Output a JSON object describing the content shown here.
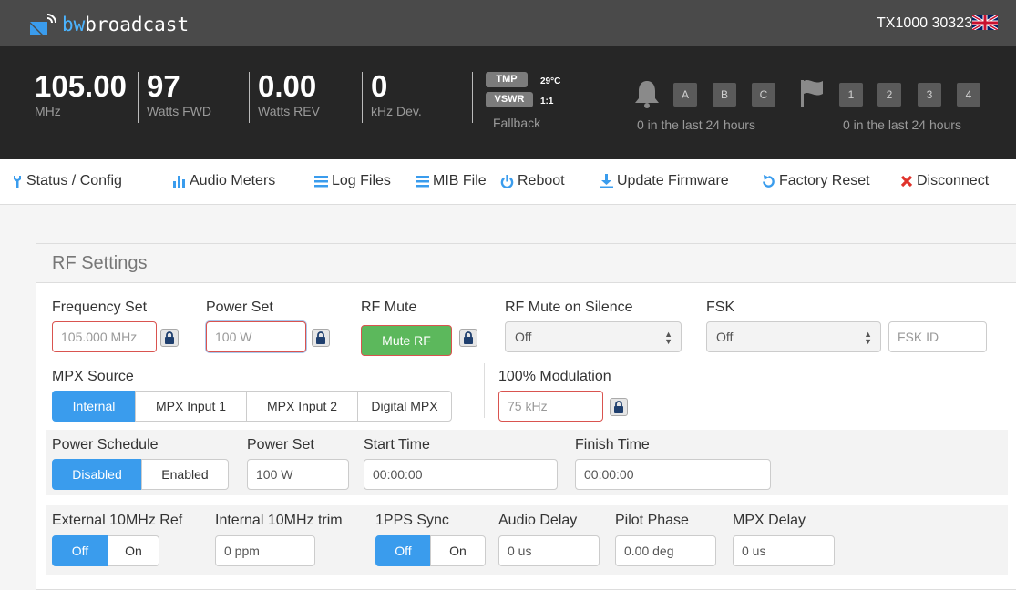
{
  "app": {
    "brand_prefix": "bw",
    "brand_suffix": "broadcast",
    "device_id": "TX1000 30323",
    "accent": "#3a9ced"
  },
  "status": {
    "frequency": {
      "value": "105.00",
      "unit": "MHz"
    },
    "fwd": {
      "value": "97",
      "unit": "Watts FWD"
    },
    "rev": {
      "value": "0.00",
      "unit": "Watts REV"
    },
    "dev": {
      "value": "0",
      "unit": "kHz Dev."
    },
    "tmp": {
      "label": "TMP",
      "value": "29°C"
    },
    "vswr": {
      "label": "VSWR",
      "value": "1:1"
    },
    "mode": "Fallback",
    "alarms": {
      "buttons": [
        "A",
        "B",
        "C"
      ],
      "summary": "0 in the last 24 hours"
    },
    "flags": {
      "buttons": [
        "1",
        "2",
        "3",
        "4"
      ],
      "summary": "0 in the last 24 hours"
    }
  },
  "nav": {
    "items": [
      {
        "label": "Status / Config",
        "icon": "wrench-icon",
        "color": "#3a9ced"
      },
      {
        "label": "Audio Meters",
        "icon": "bars-icon",
        "color": "#3a9ced"
      },
      {
        "label": "Log Files",
        "icon": "list-icon",
        "color": "#3a9ced"
      },
      {
        "label": "MIB File",
        "icon": "list-icon",
        "color": "#3a9ced"
      },
      {
        "label": "Reboot",
        "icon": "power-icon",
        "color": "#3a9ced"
      },
      {
        "label": "Update Firmware",
        "icon": "download-icon",
        "color": "#3a9ced"
      },
      {
        "label": "Factory Reset",
        "icon": "reset-icon",
        "color": "#3a9ced"
      },
      {
        "label": "Disconnect",
        "icon": "close-icon",
        "color": "#e0332b"
      }
    ]
  },
  "panel": {
    "title": "RF Settings",
    "frequency_set": {
      "label": "Frequency Set",
      "placeholder": "105.000 MHz"
    },
    "power_set": {
      "label": "Power Set",
      "placeholder": "100 W"
    },
    "rf_mute": {
      "label": "RF Mute",
      "button": "Mute RF"
    },
    "rf_mute_silence": {
      "label": "RF Mute on Silence",
      "value": "Off"
    },
    "fsk": {
      "label": "FSK",
      "value": "Off",
      "id_placeholder": "FSK ID"
    },
    "mpx_source": {
      "label": "MPX Source",
      "options": [
        "Internal",
        "MPX Input 1",
        "MPX Input 2",
        "Digital MPX"
      ],
      "selected": "Internal"
    },
    "modulation": {
      "label": "100% Modulation",
      "placeholder": "75 kHz"
    },
    "power_schedule": {
      "label": "Power Schedule",
      "options": [
        "Disabled",
        "Enabled"
      ],
      "selected": "Disabled"
    },
    "schedule_power": {
      "label": "Power Set",
      "value": "100 W"
    },
    "start_time": {
      "label": "Start Time",
      "value": "00:00:00"
    },
    "finish_time": {
      "label": "Finish Time",
      "value": "00:00:00"
    },
    "ext_ref": {
      "label": "External 10MHz Ref",
      "options": [
        "Off",
        "On"
      ],
      "selected": "Off"
    },
    "int_trim": {
      "label": "Internal 10MHz trim",
      "value": "0 ppm"
    },
    "pps_sync": {
      "label": "1PPS Sync",
      "options": [
        "Off",
        "On"
      ],
      "selected": "Off"
    },
    "audio_delay": {
      "label": "Audio Delay",
      "value": "0 us"
    },
    "pilot_phase": {
      "label": "Pilot Phase",
      "value": "0.00 deg"
    },
    "mpx_delay": {
      "label": "MPX Delay",
      "value": "0 us"
    }
  }
}
